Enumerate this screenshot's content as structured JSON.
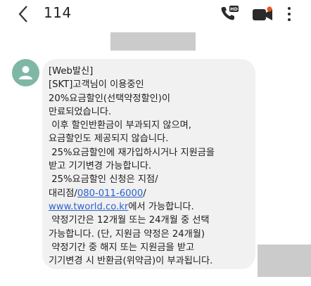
{
  "header": {
    "title": "114",
    "icons": {
      "back": "back-arrow-icon",
      "hd_call": "hd-voice-call-icon",
      "video": "video-call-icon",
      "more": "more-options-icon"
    },
    "hd_badge": "HD",
    "accent_color": "#e8551f"
  },
  "message": {
    "line1": "[Web발신]",
    "line2": "[SKT]고객님이 이용중인",
    "line3": "20%요금할인(선택약정할인)이",
    "line4": "만료되었습니다.",
    "line5": " 이후 할인반환금이 부과되지 않으며,",
    "line6": "요금할인도 제공되지 않습니다.",
    "line7": " 25%요금할인에 재가입하시거나 지원금을",
    "line8": "받고 기기변경 가능합니다.",
    "line9": " 25%요금할인 신청은 지점/",
    "line10_prefix": "대리점/",
    "line10_phone": "080-011-6000",
    "line10_suffix": "/",
    "line11_link": "www.tworld.co.kr",
    "line11_suffix": "에서 가능합니다.",
    "line12": " 약정기간은 12개월 또는 24개월 중 선택",
    "line13": "가능합니다. (단, 지원금 약정은 24개월)",
    "line14": " 약정기간 중 해지 또는 지원금을 받고",
    "line15": "기기변경 시 반환금(위약금)이 부과됩니다.",
    "link_color": "#2d62c9",
    "bubble_color": "#f1f1f1"
  },
  "avatar": {
    "icon": "person-icon",
    "color": "#7fb7a6"
  }
}
